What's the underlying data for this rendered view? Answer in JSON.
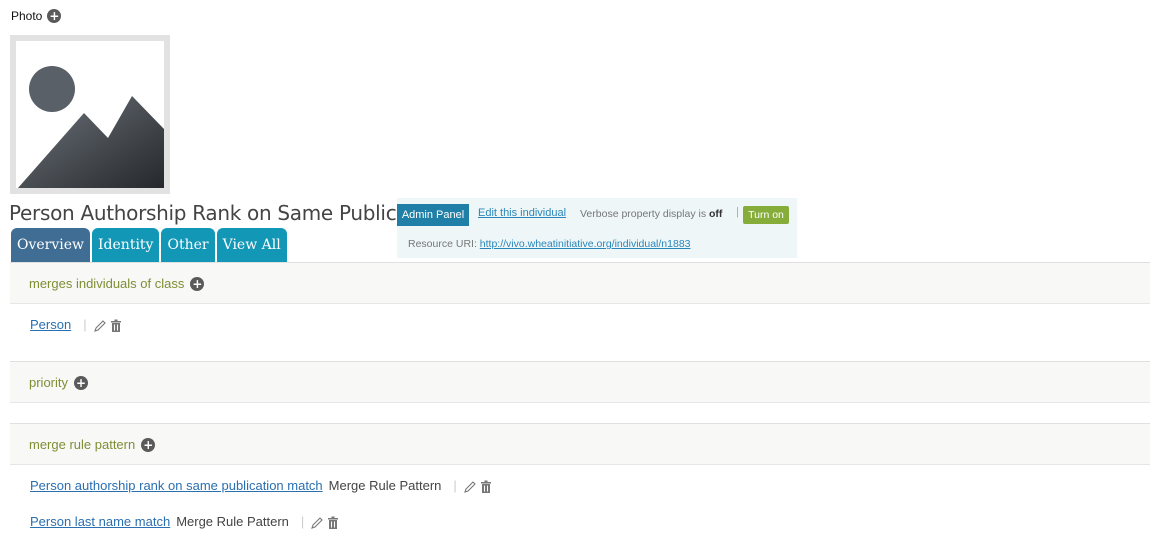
{
  "photo": {
    "label": "Photo",
    "add_icon": "plus-circle-icon",
    "placeholder_icon": "image-placeholder-icon"
  },
  "individual": {
    "title": "Person Authorship Rank on Same Publication"
  },
  "tabs": [
    {
      "label": "Overview",
      "active": true
    },
    {
      "label": "Identity",
      "active": false
    },
    {
      "label": "Other",
      "active": false
    },
    {
      "label": "View All",
      "active": false
    }
  ],
  "admin": {
    "badge": "Admin Panel",
    "edit_link": "Edit this individual",
    "verbose_prefix": "Verbose property display is",
    "verbose_state": "off",
    "separator": "|",
    "turn_on": "Turn on",
    "uri_label": "Resource URI:",
    "uri_value": "http://vivo.wheatinitiative.org/individual/n1883"
  },
  "sections": [
    {
      "title": "merges individuals of class",
      "items": [
        {
          "link": "Person",
          "type": ""
        }
      ]
    },
    {
      "title": "priority",
      "items": []
    },
    {
      "title": "merge rule pattern",
      "items": [
        {
          "link": "Person authorship rank on same publication match",
          "type": "Merge Rule Pattern"
        },
        {
          "link": "Person last name match",
          "type": "Merge Rule Pattern"
        }
      ]
    }
  ],
  "colors": {
    "tab": "#1297b6",
    "tab_active": "#3f6d94",
    "section_title": "#7f8e35",
    "link": "#2a6fb0",
    "turn_on": "#86ad3a"
  }
}
